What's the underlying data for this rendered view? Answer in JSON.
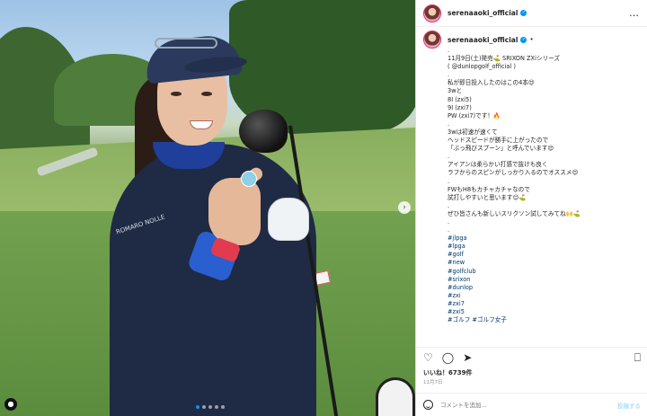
{
  "post": {
    "username": "serenaaoki_official",
    "more_icon": "…",
    "dot_separator": "•"
  },
  "caption": {
    "username": "serenaaoki_official",
    "lines": [
      ".",
      "11月9日(土)発売⛳ SRIXON ZXiシリーズ",
      "( @dunlopgolf_official )",
      ".",
      "私が即日投入したのはこの4本😍",
      "3wと",
      "8I (zxi5)",
      "9I (zxi7)",
      "PW (zxi7)です！🔥",
      ".",
      "3wは初速が速くて",
      "ヘッドスピードが勝手に上がったので",
      "「ぶっ飛びスプーン」と呼んでいます😍",
      ".",
      "アイアンは柔らかい打感で抜けも良く",
      "ラフからのスピンがしっかり入るのでオススメ😍",
      ".",
      "FWもH8もカチャカチャなので",
      "試打しやすいと思います😊⛳",
      ".",
      "ぜひ皆さんも新しいスリクソン試してみてね🙌⛳",
      ".",
      ".",
      "#jlpga",
      "#lpga",
      "#golf",
      "#new",
      "#golfclub",
      "#srixon",
      "#dunlop",
      "#zxi",
      "#zxi7",
      "#zxi5",
      "#ゴルフ #ゴルフ女子"
    ]
  },
  "actions": {
    "like_icon": "♡",
    "comment_icon": "◯",
    "share_icon": "➤",
    "save_icon": "⎕"
  },
  "likes": "いいね！6739件",
  "date": "11月7日",
  "comment": {
    "placeholder": "コメントを追加...",
    "post_label": "投稿する"
  },
  "photo": {
    "jacket_text": "ROMARO NOLLE",
    "next_arrow": "›",
    "user_tag_icon": "●",
    "carousel_count": 5,
    "carousel_active": 0
  }
}
